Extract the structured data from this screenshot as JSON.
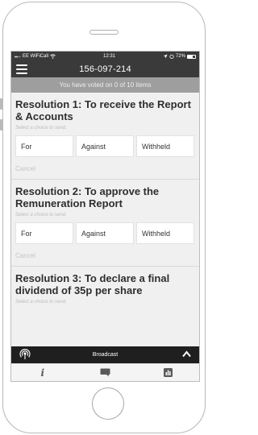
{
  "status_bar": {
    "carrier": "EE WiFiCall",
    "time": "12:31",
    "battery": "72%",
    "battery_level": 0.72
  },
  "header": {
    "title": "156-097-214"
  },
  "banner": {
    "text": "You have voted on 0 of 10 items"
  },
  "resolutions": [
    {
      "title": "Resolution 1: To receive the Report & Accounts",
      "hint": "Select a choice to send.",
      "choices": [
        "For",
        "Against",
        "Withheld"
      ],
      "cancel": "Cancel"
    },
    {
      "title": "Resolution 2: To approve the Remuneration Report",
      "hint": "Select a choice to send.",
      "choices": [
        "For",
        "Against",
        "Withheld"
      ],
      "cancel": "Cancel"
    },
    {
      "title": "Resolution 3: To declare a final dividend of 35p per share",
      "hint": "Select a choice to send."
    }
  ],
  "broadcast": {
    "label": "Broadcast"
  },
  "tabs": {
    "info_glyph": "i",
    "icons": [
      "info-icon",
      "chat-icon",
      "chart-icon"
    ]
  },
  "colors": {
    "header_bg": "#3a3a3a",
    "banner_bg": "#9e9e9e",
    "broadcast_bg": "#1f1f1f",
    "screen_bg": "#f0f0f0"
  }
}
